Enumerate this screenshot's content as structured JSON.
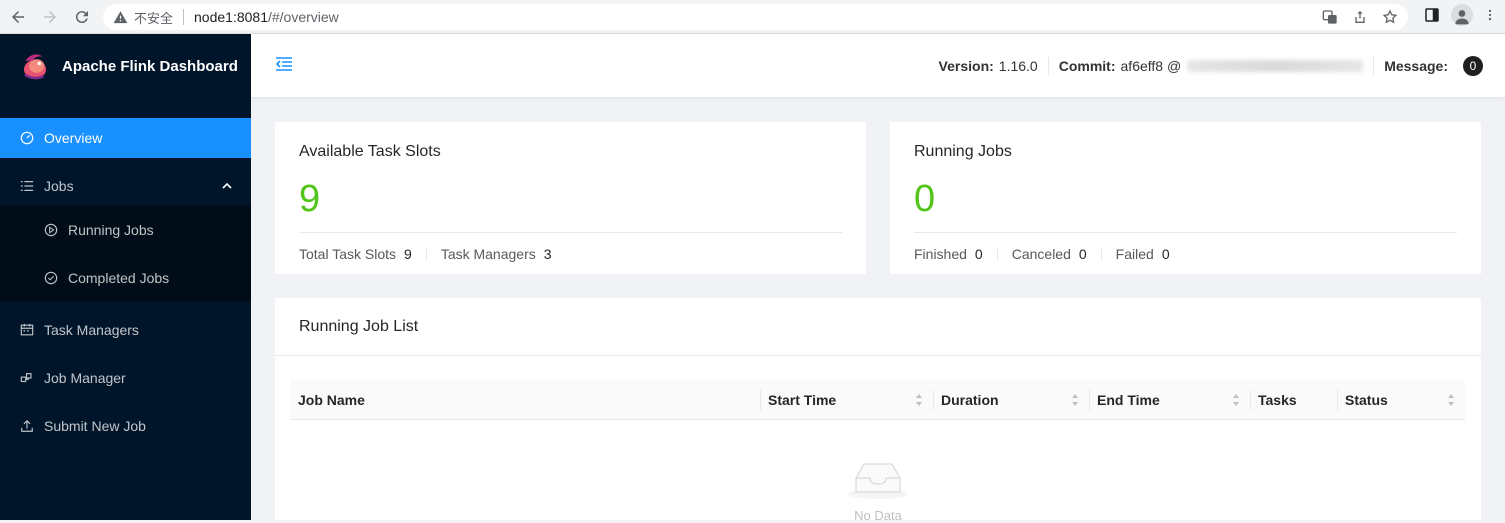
{
  "browser": {
    "security_label": "不安全",
    "url_host": "node1:8081",
    "url_path": "/#/overview"
  },
  "app": {
    "title": "Apache Flink Dashboard"
  },
  "sidebar": {
    "items": [
      {
        "label": "Overview",
        "icon": "dashboard-icon",
        "active": true
      },
      {
        "label": "Jobs",
        "icon": "list-icon",
        "expanded": true
      },
      {
        "label": "Running Jobs",
        "icon": "play-circle-icon",
        "sub": true
      },
      {
        "label": "Completed Jobs",
        "icon": "check-circle-icon",
        "sub": true
      },
      {
        "label": "Task Managers",
        "icon": "schedule-icon"
      },
      {
        "label": "Job Manager",
        "icon": "cluster-icon"
      },
      {
        "label": "Submit New Job",
        "icon": "upload-icon"
      }
    ]
  },
  "header": {
    "version_label": "Version:",
    "version_value": "1.16.0",
    "commit_label": "Commit:",
    "commit_value": "af6eff8 @",
    "message_label": "Message:",
    "message_count": "0"
  },
  "task_slots": {
    "title": "Available Task Slots",
    "value": "9",
    "total_label": "Total Task Slots",
    "total_value": "9",
    "tm_label": "Task Managers",
    "tm_value": "3"
  },
  "running_jobs": {
    "title": "Running Jobs",
    "value": "0",
    "finished_label": "Finished",
    "finished_value": "0",
    "canceled_label": "Canceled",
    "canceled_value": "0",
    "failed_label": "Failed",
    "failed_value": "0"
  },
  "job_list": {
    "title": "Running Job List",
    "columns": [
      "Job Name",
      "Start Time",
      "Duration",
      "End Time",
      "Tasks",
      "Status"
    ],
    "empty_text": "No Data"
  },
  "colors": {
    "sidebar_bg": "#001529",
    "accent": "#1890ff",
    "success": "#52c41a"
  }
}
